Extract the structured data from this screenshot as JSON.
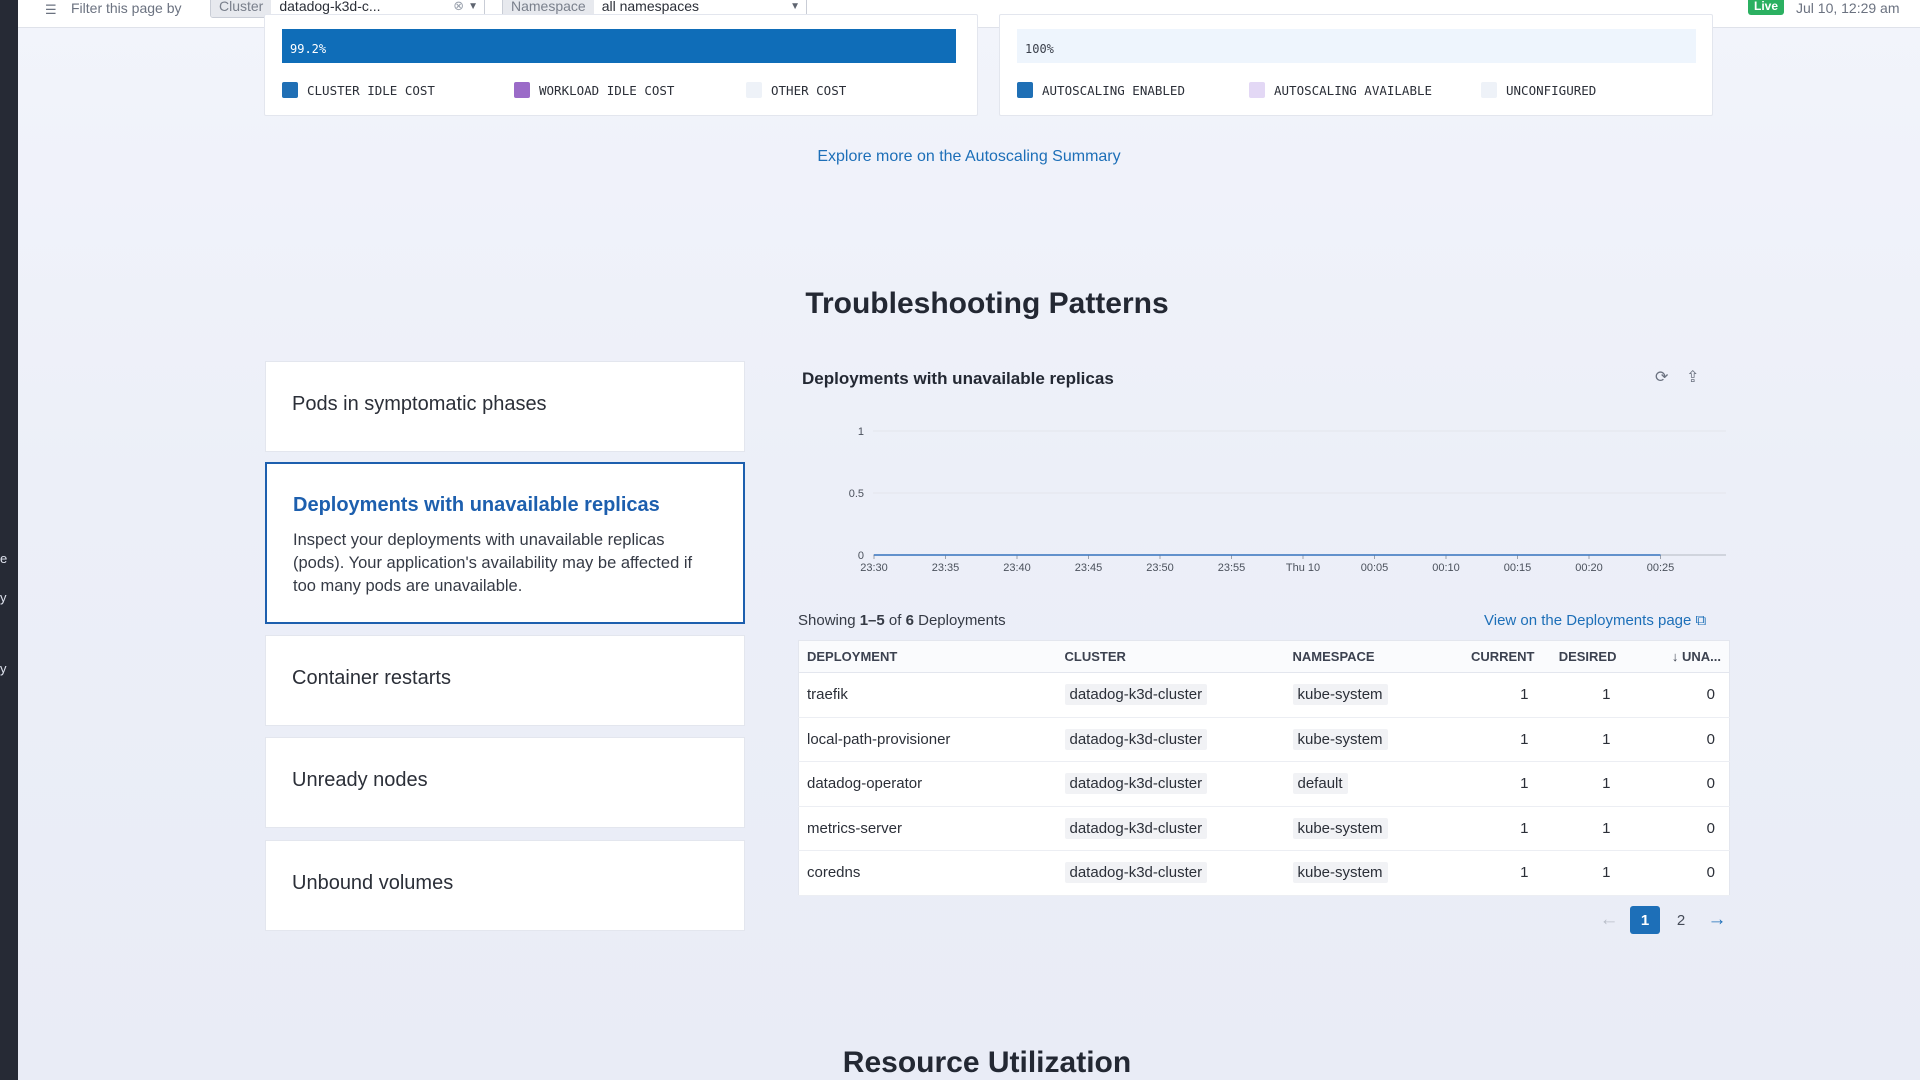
{
  "filter_bar": {
    "label": "Filter this page by",
    "cluster_key": "Cluster",
    "cluster_value": "datadog-k3d-c...",
    "namespace_key": "Namespace",
    "namespace_value": "all namespaces",
    "live_label": "Live",
    "time": "Jul 10, 12:29 am"
  },
  "rail_glyphs": [
    "e",
    "y",
    "y"
  ],
  "cost_card": {
    "bar_value": "99.2%",
    "bar_fraction": 0.992,
    "legend": [
      {
        "label": "CLUSTER IDLE COST",
        "color": "#1f6fb5"
      },
      {
        "label": "WORKLOAD IDLE COST",
        "color": "#9b6bc8"
      },
      {
        "label": "OTHER COST",
        "color": "#eef2f8"
      }
    ]
  },
  "autoscaling_card": {
    "bar_value": "100%",
    "legend": [
      {
        "label": "AUTOSCALING ENABLED",
        "color": "#1f6fb5"
      },
      {
        "label": "AUTOSCALING AVAILABLE",
        "color": "#e3d8f5"
      },
      {
        "label": "UNCONFIGURED",
        "color": "#eef2f8"
      }
    ]
  },
  "explore_link": "Explore more on the Autoscaling Summary",
  "troubleshooting": {
    "title": "Troubleshooting Patterns",
    "patterns": [
      {
        "title": "Pods in symptomatic phases"
      },
      {
        "title": "Deployments with unavailable replicas",
        "description": "Inspect your deployments with unavailable replicas (pods). Your application's availability may be affected if too many pods are unavailable."
      },
      {
        "title": "Container restarts"
      },
      {
        "title": "Unready nodes"
      },
      {
        "title": "Unbound volumes"
      }
    ]
  },
  "panel": {
    "title": "Deployments with unavailable replicas",
    "icons": [
      "sync-icon",
      "export-icon"
    ]
  },
  "chart_data": {
    "type": "line",
    "title": "Deployments with unavailable replicas",
    "x": [
      "23:30",
      "23:35",
      "23:40",
      "23:45",
      "23:50",
      "23:55",
      "Thu 10",
      "00:05",
      "00:10",
      "00:15",
      "00:20",
      "00:25"
    ],
    "y_ticks": [
      "1",
      "0.5",
      "0"
    ],
    "ylim": [
      0,
      1
    ],
    "series": [
      {
        "values": [
          0,
          0,
          0,
          0,
          0,
          0,
          0,
          0,
          0,
          0,
          0,
          0
        ]
      }
    ],
    "grid": true
  },
  "table": {
    "showing_prefix": "Showing",
    "showing_range": "1–5",
    "showing_of": "of",
    "showing_total": "6",
    "showing_suffix": "Deployments",
    "deployments_link": "View on the Deployments page",
    "columns": [
      "DEPLOYMENT",
      "CLUSTER",
      "NAMESPACE",
      "CURRENT",
      "DESIRED",
      "UNA..."
    ],
    "rows": [
      {
        "deployment": "traefik",
        "cluster": "datadog-k3d-cluster",
        "namespace": "kube-system",
        "current": "1",
        "desired": "1",
        "unavailable": "0"
      },
      {
        "deployment": "local-path-provisioner",
        "cluster": "datadog-k3d-cluster",
        "namespace": "kube-system",
        "current": "1",
        "desired": "1",
        "unavailable": "0"
      },
      {
        "deployment": "datadog-operator",
        "cluster": "datadog-k3d-cluster",
        "namespace": "default",
        "current": "1",
        "desired": "1",
        "unavailable": "0"
      },
      {
        "deployment": "metrics-server",
        "cluster": "datadog-k3d-cluster",
        "namespace": "kube-system",
        "current": "1",
        "desired": "1",
        "unavailable": "0"
      },
      {
        "deployment": "coredns",
        "cluster": "datadog-k3d-cluster",
        "namespace": "kube-system",
        "current": "1",
        "desired": "1",
        "unavailable": "0"
      }
    ],
    "pagination": {
      "prev": "←",
      "pages": [
        "1",
        "2"
      ],
      "current": "1",
      "next": "→"
    }
  },
  "resource_utilization": {
    "title": "Resource Utilization"
  }
}
